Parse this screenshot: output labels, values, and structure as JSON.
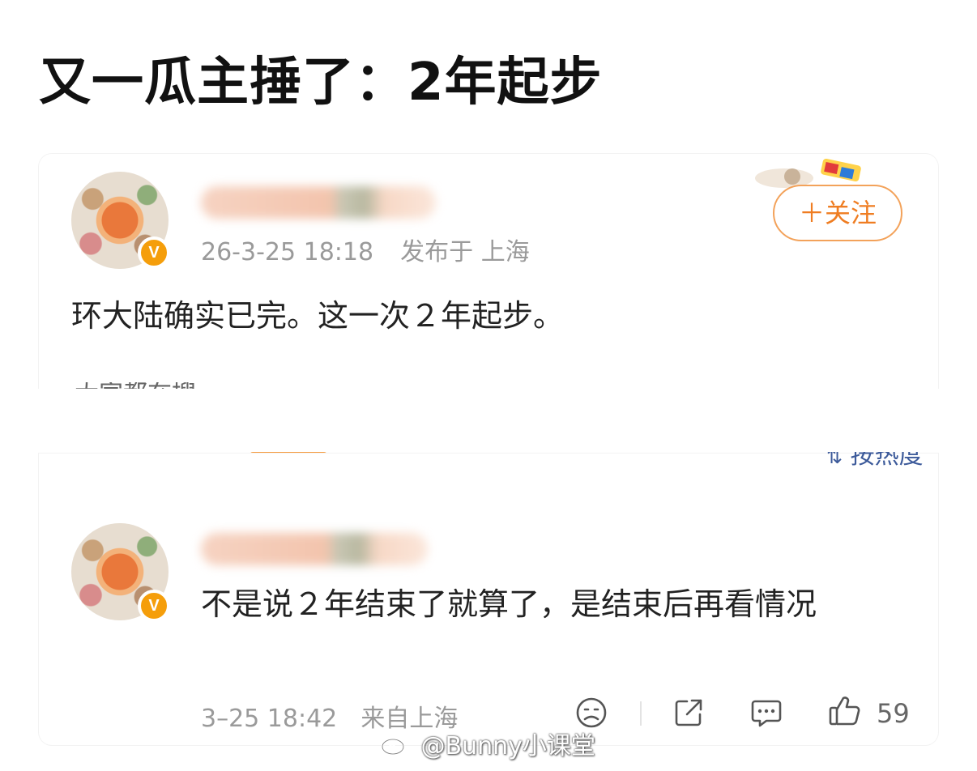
{
  "headline": "又一瓜主捶了：2年起步",
  "post": {
    "timestamp": "26-3-25 18:18",
    "location": "发布于 上海",
    "follow_label": "＋关注",
    "text": "环大陆确实已完。这一次２年起步。",
    "partial_text": "大家都在搜"
  },
  "sort_label": "按热度",
  "comment": {
    "text": "不是说２年结束了就算了，是结束后再看情况",
    "time": "3–25 18:42",
    "location": "来自上海",
    "like_count": "59"
  },
  "verified_badge": "V",
  "watermark": "@Bunny小课堂",
  "colors": {
    "accent": "#ef7d22",
    "badge": "#f59e0b",
    "meta_text": "#9a9a9a"
  },
  "icons": [
    "verified-badge-icon",
    "sad-face-icon",
    "share-icon",
    "comment-icon",
    "thumbs-up-icon",
    "weibo-logo-icon"
  ]
}
